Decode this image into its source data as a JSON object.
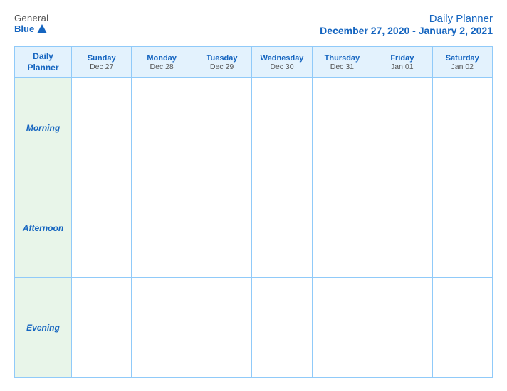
{
  "header": {
    "logo_general": "General",
    "logo_blue": "Blue",
    "title_main": "Daily Planner",
    "title_sub": "December 27, 2020 - January 2, 2021"
  },
  "table": {
    "col_header_label": "Daily\nPlanner",
    "columns": [
      {
        "day": "Sunday",
        "date": "Dec 27"
      },
      {
        "day": "Monday",
        "date": "Dec 28"
      },
      {
        "day": "Tuesday",
        "date": "Dec 29"
      },
      {
        "day": "Wednesday",
        "date": "Dec 30"
      },
      {
        "day": "Thursday",
        "date": "Dec 31"
      },
      {
        "day": "Friday",
        "date": "Jan 01"
      },
      {
        "day": "Saturday",
        "date": "Jan 02"
      }
    ],
    "rows": [
      {
        "label": "Morning"
      },
      {
        "label": "Afternoon"
      },
      {
        "label": "Evening"
      }
    ]
  }
}
